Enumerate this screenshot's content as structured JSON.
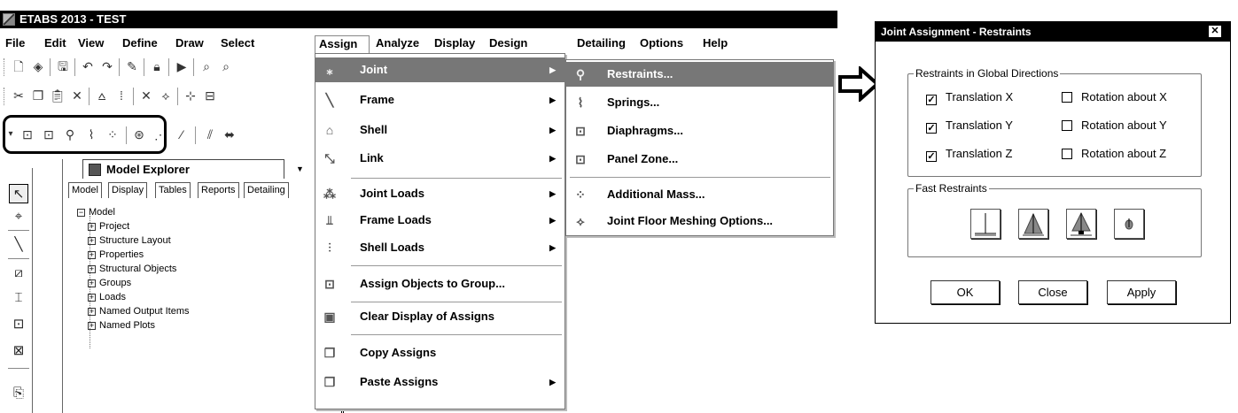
{
  "app": {
    "title": "ETABS 2013  - TEST",
    "menu": [
      "File",
      "Edit",
      "View",
      "Define",
      "Draw",
      "Select",
      "Assign",
      "Analyze",
      "Display",
      "Design",
      "Detailing",
      "Options",
      "Help"
    ],
    "active_menu": "Assign"
  },
  "explorer": {
    "title": "Model Explorer",
    "tabs": [
      "Model",
      "Display",
      "Tables",
      "Reports",
      "Detailing"
    ],
    "tree": {
      "root": "Model",
      "children": [
        "Project",
        "Structure Layout",
        "Properties",
        "Structural Objects",
        "Groups",
        "Loads",
        "Named Output Items",
        "Named Plots"
      ]
    }
  },
  "assign_menu": {
    "items": [
      {
        "label": "Joint",
        "icon": "joint-icon",
        "submenu": true,
        "highlighted": true
      },
      {
        "label": "Frame",
        "icon": "frame-icon",
        "submenu": true
      },
      {
        "label": "Shell",
        "icon": "shell-icon",
        "submenu": true
      },
      {
        "label": "Link",
        "icon": "link-icon",
        "submenu": true
      },
      {
        "label": "Joint Loads",
        "icon": "joint-loads-icon",
        "submenu": true
      },
      {
        "label": "Frame Loads",
        "icon": "frame-loads-icon",
        "submenu": true
      },
      {
        "label": "Shell Loads",
        "icon": "shell-loads-icon",
        "submenu": true
      },
      {
        "label": "Assign Objects to Group...",
        "icon": "group-icon",
        "submenu": false
      },
      {
        "label": "Clear Display of Assigns",
        "icon": "clear-display-icon",
        "submenu": false
      },
      {
        "label": "Copy Assigns",
        "icon": "copy-icon",
        "submenu": false
      },
      {
        "label": "Paste Assigns",
        "icon": "paste-icon",
        "submenu": true
      }
    ]
  },
  "joint_submenu": {
    "items": [
      {
        "label": "Restraints...",
        "icon": "restraints-icon",
        "highlighted": true
      },
      {
        "label": "Springs...",
        "icon": "springs-icon"
      },
      {
        "label": "Diaphragms...",
        "icon": "diaphragms-icon"
      },
      {
        "label": "Panel Zone...",
        "icon": "panel-zone-icon"
      },
      {
        "label": "Additional Mass...",
        "icon": "additional-mass-icon"
      },
      {
        "label": "Joint Floor Meshing Options...",
        "icon": "floor-meshing-icon"
      }
    ]
  },
  "dialog": {
    "title": "Joint Assignment - Restraints",
    "close_glyph": "✕",
    "group_global": "Restraints in Global Directions",
    "checkboxes": [
      {
        "label": "Translation X",
        "checked": true
      },
      {
        "label": "Translation Y",
        "checked": true
      },
      {
        "label": "Translation Z",
        "checked": true
      },
      {
        "label": "Rotation about X",
        "checked": false
      },
      {
        "label": "Rotation about Y",
        "checked": false
      },
      {
        "label": "Rotation about Z",
        "checked": false
      }
    ],
    "group_fast": "Fast Restraints",
    "fast_buttons": [
      "fixed-restraint-icon",
      "pinned-restraint-icon",
      "roller-restraint-icon",
      "free-restraint-icon"
    ],
    "buttons": {
      "ok": "OK",
      "close": "Close",
      "apply": "Apply"
    }
  },
  "colors": {
    "highlight": "#777777",
    "titlebar": "#000000"
  }
}
